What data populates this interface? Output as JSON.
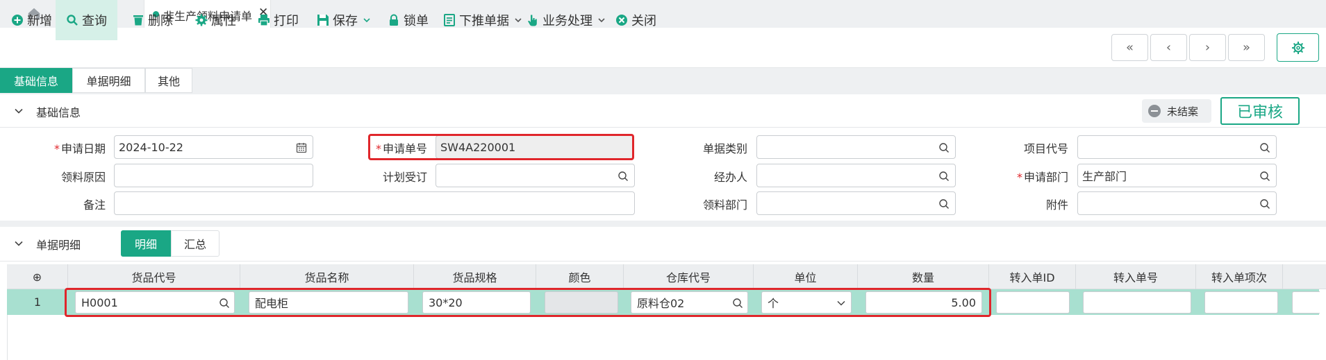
{
  "tabs": {
    "doc_tab_label": "非生产领料申请单",
    "close_glyph": "✕"
  },
  "toolbar": {
    "new": "新增",
    "query": "查询",
    "delete": "删除",
    "properties": "属性",
    "print": "打印",
    "save": "保存",
    "lock": "锁单",
    "push_down": "下推单据",
    "business": "业务处理",
    "close": "关闭",
    "nav_first": "«",
    "nav_prev": "‹",
    "nav_next": "›",
    "nav_last": "»"
  },
  "subtabs": [
    "基础信息",
    "单据明细",
    "其他"
  ],
  "basic": {
    "title": "基础信息",
    "status": "未结案",
    "approved": "已审核",
    "fields": {
      "apply_date_label": "申请日期",
      "apply_date_value": "2024-10-22",
      "apply_no_label": "申请单号",
      "apply_no_value": "SW4A220001",
      "doc_type_label": "单据类别",
      "doc_type_value": "",
      "project_code_label": "项目代号",
      "project_code_value": "",
      "reason_label": "领料原因",
      "reason_value": "",
      "plan_order_label": "计划受订",
      "plan_order_value": "",
      "handler_label": "经办人",
      "handler_value": "",
      "apply_dept_label": "申请部门",
      "apply_dept_value": "生产部门",
      "remark_label": "备注",
      "remark_value": "",
      "pick_dept_label": "领料部门",
      "pick_dept_value": "",
      "attach_label": "附件",
      "attach_value": ""
    }
  },
  "detail": {
    "title": "单据明细",
    "toggle": [
      "明细",
      "汇总"
    ],
    "add_glyph": "⊕",
    "columns": [
      "货品代号",
      "货品名称",
      "货品规格",
      "颜色",
      "仓库代号",
      "单位",
      "数量",
      "转入单ID",
      "转入单号",
      "转入单项次"
    ],
    "rows": [
      {
        "no": "1",
        "code": "H0001",
        "name": "配电柜",
        "spec": "30*20",
        "color": "",
        "warehouse": "原料仓02",
        "unit": "个",
        "qty": "5.00",
        "in_id": "",
        "in_no": "",
        "in_item": ""
      }
    ]
  },
  "colors": {
    "accent": "#1aa785",
    "highlight": "#e0262b",
    "row_selected": "#a8e0d0"
  }
}
